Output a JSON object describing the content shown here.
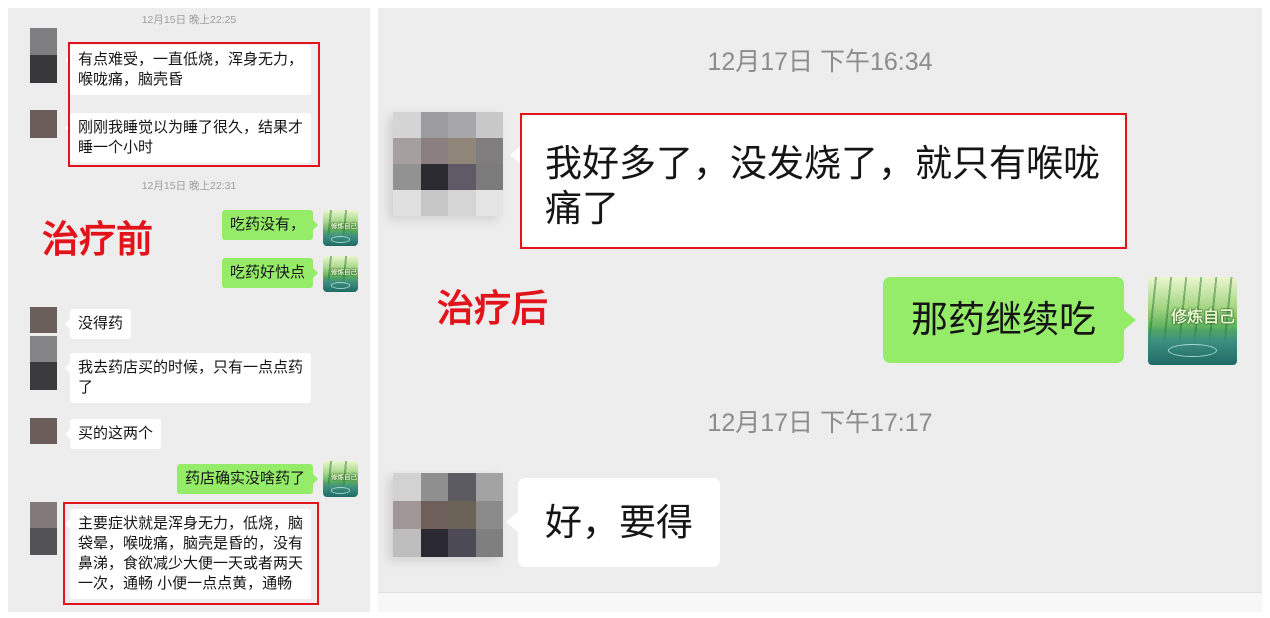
{
  "colors": {
    "chat_background": "#ededed",
    "sent_bubble": "#95ec69",
    "received_bubble": "#ffffff",
    "highlight_red": "#e3131b",
    "timestamp_text": "#8c8c8c"
  },
  "avatar_logo_text": "修炼自己",
  "left_panel": {
    "label": "治疗前",
    "timestamps": [
      "12月15日 晚上22:25",
      "12月15日 晚上22:31"
    ],
    "messages": [
      {
        "sent": false,
        "lines": [
          "有点难受，一直低烧，浑身无力，",
          "喉咙痛，脑壳昏"
        ]
      },
      {
        "sent": false,
        "lines": [
          "刚刚我睡觉以为睡了很久，结果才",
          "睡一个小时"
        ]
      },
      {
        "sent": true,
        "lines": [
          "吃药没有，"
        ]
      },
      {
        "sent": true,
        "lines": [
          "吃药好快点"
        ]
      },
      {
        "sent": false,
        "lines": [
          "没得药"
        ]
      },
      {
        "sent": false,
        "lines": [
          "我去药店买的时候，只有一点点药",
          "了"
        ]
      },
      {
        "sent": false,
        "lines": [
          "买的这两个"
        ]
      },
      {
        "sent": true,
        "lines": [
          "药店确实没啥药了"
        ]
      },
      {
        "sent": false,
        "lines": [
          "主要症状就是浑身无力，低烧，脑",
          "袋晕，喉咙痛，脑壳是昏的，没有",
          "鼻涕，食欲减少大便一天或者两天",
          "一次，通畅 小便一点点黄，通畅"
        ]
      }
    ]
  },
  "right_panel": {
    "label": "治疗后",
    "timestamps": [
      "12月17日 下午16:34",
      "12月17日 下午17:17"
    ],
    "messages": [
      {
        "sent": false,
        "lines": [
          "我好多了，没发烧了，就只有喉咙",
          "痛了"
        ]
      },
      {
        "sent": true,
        "lines": [
          "那药继续吃"
        ]
      },
      {
        "sent": false,
        "lines": [
          "好，要得"
        ]
      }
    ]
  }
}
